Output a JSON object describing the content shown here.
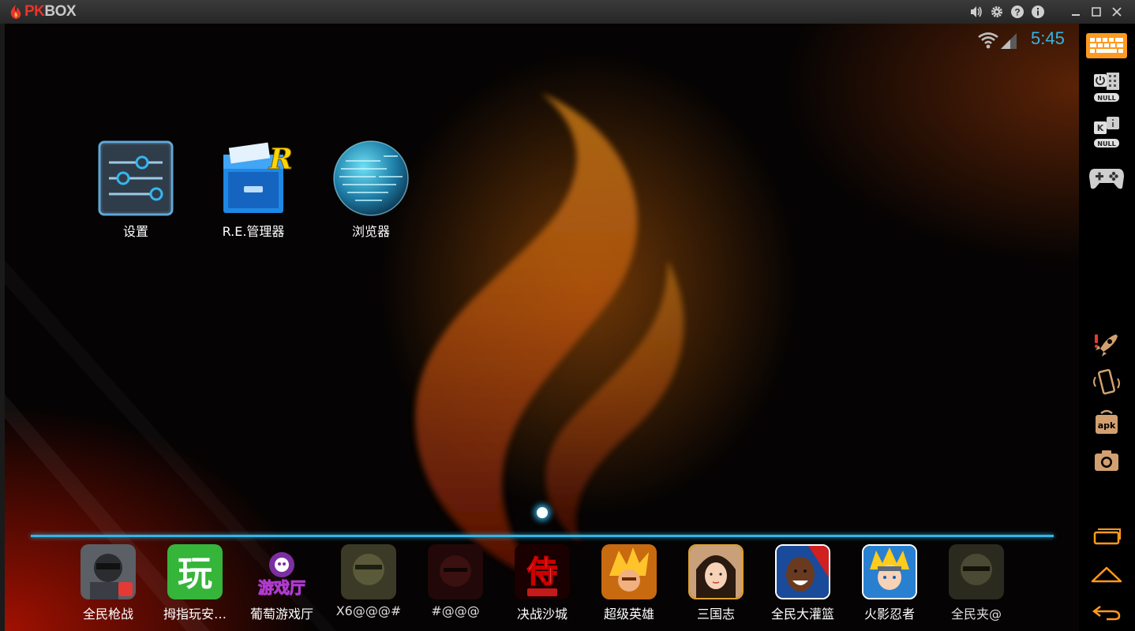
{
  "window": {
    "logo_pk": "PK",
    "logo_box": "BOX",
    "title_icons": [
      "volume-icon",
      "gear-icon",
      "help-icon",
      "info-icon",
      "minimize-icon",
      "maximize-icon",
      "close-icon"
    ]
  },
  "status_bar": {
    "time": "5:45"
  },
  "home_apps": [
    {
      "label": "设置",
      "icon": "settings-icon"
    },
    {
      "label": "R.E.管理器",
      "icon": "file-manager-icon"
    },
    {
      "label": "浏览器",
      "icon": "browser-globe-icon"
    }
  ],
  "dock": [
    {
      "label": "全民枪战",
      "color": "#5b5f66"
    },
    {
      "label": "拇指玩安…",
      "color": "#35b53a"
    },
    {
      "label": "葡萄游戏厅",
      "color": "#6a2a8a"
    },
    {
      "label": "X6@@@#",
      "color": "#4a4a2a"
    },
    {
      "label": "#@@@",
      "color": "#3a1010"
    },
    {
      "label": "决战沙城",
      "color": "#8a0000"
    },
    {
      "label": "超级英雄",
      "color": "#c86a10"
    },
    {
      "label": "三国志",
      "color": "#c89060"
    },
    {
      "label": "全民大灌篮",
      "color": "#1a4a9a"
    },
    {
      "label": "火影忍者",
      "color": "#2a80d0"
    },
    {
      "label": "全民夹@",
      "color": "#3a3a2a"
    }
  ],
  "sidebar": {
    "null_label_1": "NULL",
    "null_label_2": "NULL",
    "apk_label": "apk"
  },
  "colors": {
    "accent": "#33b5e5",
    "sidebar_icon": "#d2a070",
    "orange": "#ff9a1e"
  }
}
